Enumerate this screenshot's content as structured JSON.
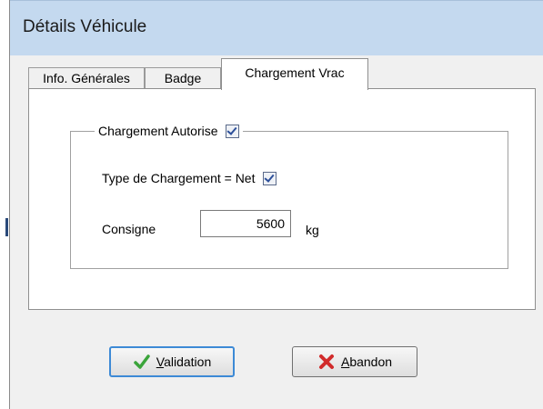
{
  "window": {
    "title": "Détails Véhicule"
  },
  "tabs": [
    {
      "label": "Info. Générales"
    },
    {
      "label": "Badge"
    },
    {
      "label": "Chargement Vrac"
    }
  ],
  "group": {
    "title": "Chargement Autorise",
    "autorise_checked": true,
    "type_label": "Type de Chargement = Net",
    "type_checked": true,
    "consigne_label": "Consigne",
    "consigne_value": "5600",
    "unit": "kg"
  },
  "buttons": {
    "validation_first": "V",
    "validation_rest": "alidation",
    "abandon_first": "A",
    "abandon_rest": "bandon"
  },
  "colors": {
    "titlebar": "#c4d9ef",
    "accent": "#3d8ad6",
    "ok_icon": "#3aa43a",
    "cancel_icon": "#d12b2b"
  },
  "icons": {
    "validate": "check-icon",
    "cancel": "x-icon"
  }
}
